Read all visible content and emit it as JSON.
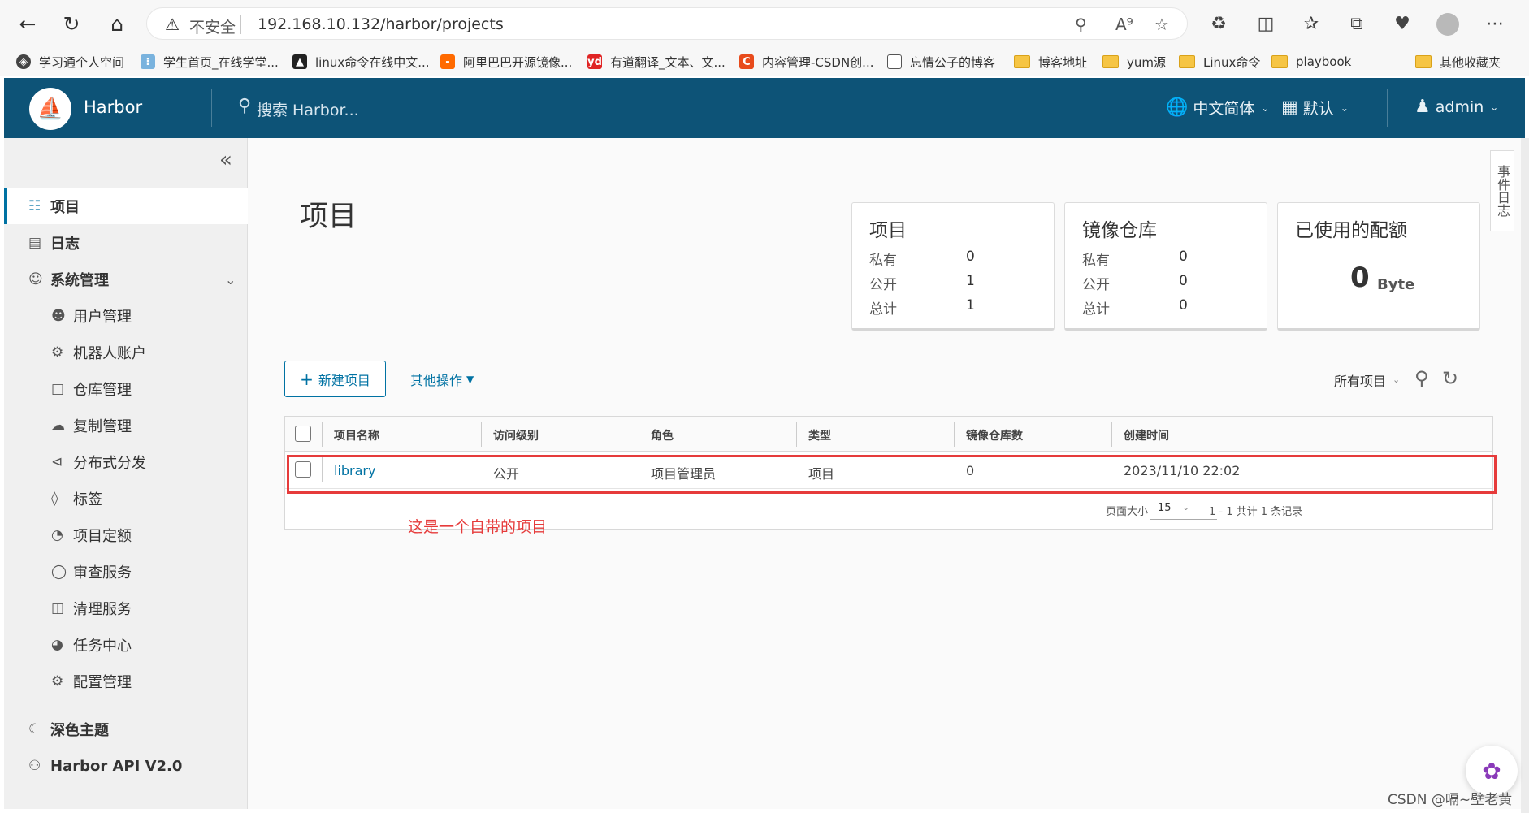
{
  "browser": {
    "insecure_label": "不安全",
    "url": "192.168.10.132/harbor/projects"
  },
  "bookmarks": [
    {
      "label": "学习通个人空间",
      "icon": "globe-icon"
    },
    {
      "label": "学生首页_在线学堂...",
      "icon": "site-icon"
    },
    {
      "label": "linux命令在线中文...",
      "icon": "linux-icon"
    },
    {
      "label": "阿里巴巴开源镜像...",
      "icon": "aliyun-icon"
    },
    {
      "label": "有道翻译_文本、文...",
      "icon": "youdao-icon"
    },
    {
      "label": "内容管理-CSDN创...",
      "icon": "csdn-icon"
    },
    {
      "label": "忘情公子的博客",
      "icon": "page-icon"
    },
    {
      "label": "博客地址",
      "icon": "folder-icon"
    },
    {
      "label": "yum源",
      "icon": "folder-icon"
    },
    {
      "label": "Linux命令",
      "icon": "folder-icon"
    },
    {
      "label": "playbook",
      "icon": "folder-icon"
    },
    {
      "label": "其他收藏夹",
      "icon": "folder-icon"
    }
  ],
  "header": {
    "brand": "Harbor",
    "search_placeholder": "搜索 Harbor...",
    "language": "中文简体",
    "theme": "默认",
    "user": "admin",
    "bg_color": "#0d5377"
  },
  "sidebar": {
    "items": [
      {
        "label": "项目"
      },
      {
        "label": "日志"
      },
      {
        "label": "系统管理"
      },
      {
        "label": "用户管理"
      },
      {
        "label": "机器人账户"
      },
      {
        "label": "仓库管理"
      },
      {
        "label": "复制管理"
      },
      {
        "label": "分布式分发"
      },
      {
        "label": "标签"
      },
      {
        "label": "项目定额"
      },
      {
        "label": "审查服务"
      },
      {
        "label": "清理服务"
      },
      {
        "label": "任务中心"
      },
      {
        "label": "配置管理"
      }
    ],
    "dark_theme": "深色主题",
    "api": "Harbor API V2.0"
  },
  "main": {
    "title": "项目",
    "cards": {
      "projects": {
        "title": "项目",
        "private_label": "私有",
        "private": "0",
        "public_label": "公开",
        "public": "1",
        "total_label": "总计",
        "total": "1"
      },
      "repos": {
        "title": "镜像仓库",
        "private_label": "私有",
        "private": "0",
        "public_label": "公开",
        "public": "0",
        "total_label": "总计",
        "total": "0"
      },
      "quota": {
        "title": "已使用的配额",
        "value": "0",
        "unit": "Byte"
      }
    },
    "new_project": "新建项目",
    "other_actions": "其他操作",
    "filter": "所有项目",
    "table": {
      "headers": [
        "项目名称",
        "访问级别",
        "角色",
        "类型",
        "镜像仓库数",
        "创建时间"
      ],
      "rows": [
        {
          "name": "library",
          "access": "公开",
          "role": "项目管理员",
          "type": "项目",
          "repo_count": "0",
          "created": "2023/11/10 22:02"
        }
      ],
      "page_size_label": "页面大小",
      "page_size": "15",
      "summary": "1 - 1 共计 1 条记录"
    },
    "annotation": "这是一个自带的项目"
  },
  "right_tab": "事件日志",
  "watermark": "CSDN @嗝~壁老黄",
  "accent_color": "#0072a3",
  "highlight_color": "#e63b3b"
}
